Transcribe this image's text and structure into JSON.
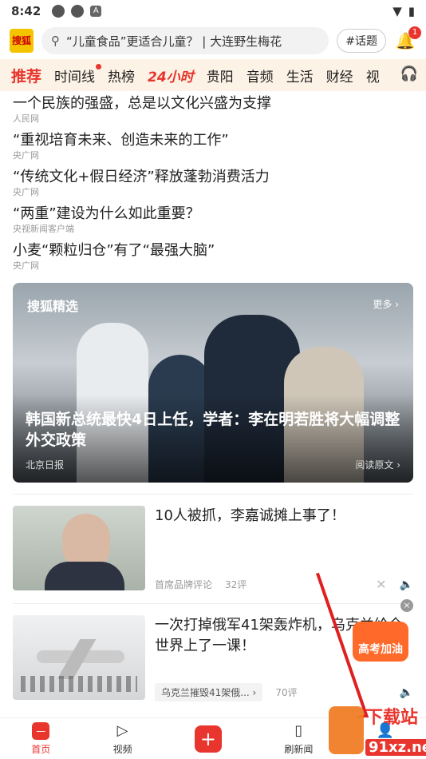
{
  "status_bar": {
    "time": "8:42"
  },
  "header": {
    "logo_text": "搜狐",
    "search_placeholder": "“儿童食品”更适合儿童？ | 大连野生梅花",
    "topic_button": "#话题",
    "notification_count": "1"
  },
  "channels": [
    "推荐",
    "时间线",
    "热榜",
    "24小时",
    "贵阳",
    "音频",
    "生活",
    "财经",
    "视"
  ],
  "hot_list": [
    {
      "title": "一个民族的强盛，总是以文化兴盛为支撑",
      "source": "人民网"
    },
    {
      "title": "“重视培育未来、创造未来的工作”",
      "source": "央广网"
    },
    {
      "title": "“传统文化+假日经济”释放蓬勃消费活力",
      "source": "央广网"
    },
    {
      "title": "“两重”建设为什么如此重要？",
      "source": "央视新闻客户端"
    },
    {
      "title": "小麦“颗粒归仓”有了“最强大脑”",
      "source": "央广网"
    }
  ],
  "featured": {
    "brand": "搜狐精选",
    "more": "更多 ›",
    "title": "韩国新总统最快4日上任，学者：李在明若胜将大幅调整外交政策",
    "source": "北京日报",
    "read_original": "阅读原文 ›"
  },
  "news": [
    {
      "title": "10人被抓，李嘉诚摊上事了！",
      "source": "首席品牌评论",
      "comments": "32评"
    },
    {
      "title": "一次打掉俄军41架轰炸机，乌克兰给全世界上了一课！",
      "tag": "乌克兰摧毁41架俄...",
      "comments": "70评"
    }
  ],
  "promo": {
    "label": "高考加油"
  },
  "tabbar": [
    {
      "label": "首页"
    },
    {
      "label": "视频"
    },
    {
      "label": ""
    },
    {
      "label": "刷新闻"
    },
    {
      "label": "我的"
    }
  ],
  "watermark": {
    "text": "下载站",
    "url": "91xz.net"
  },
  "colors": {
    "accent": "#e8352d",
    "channel_bg": "#fdf2e6"
  }
}
